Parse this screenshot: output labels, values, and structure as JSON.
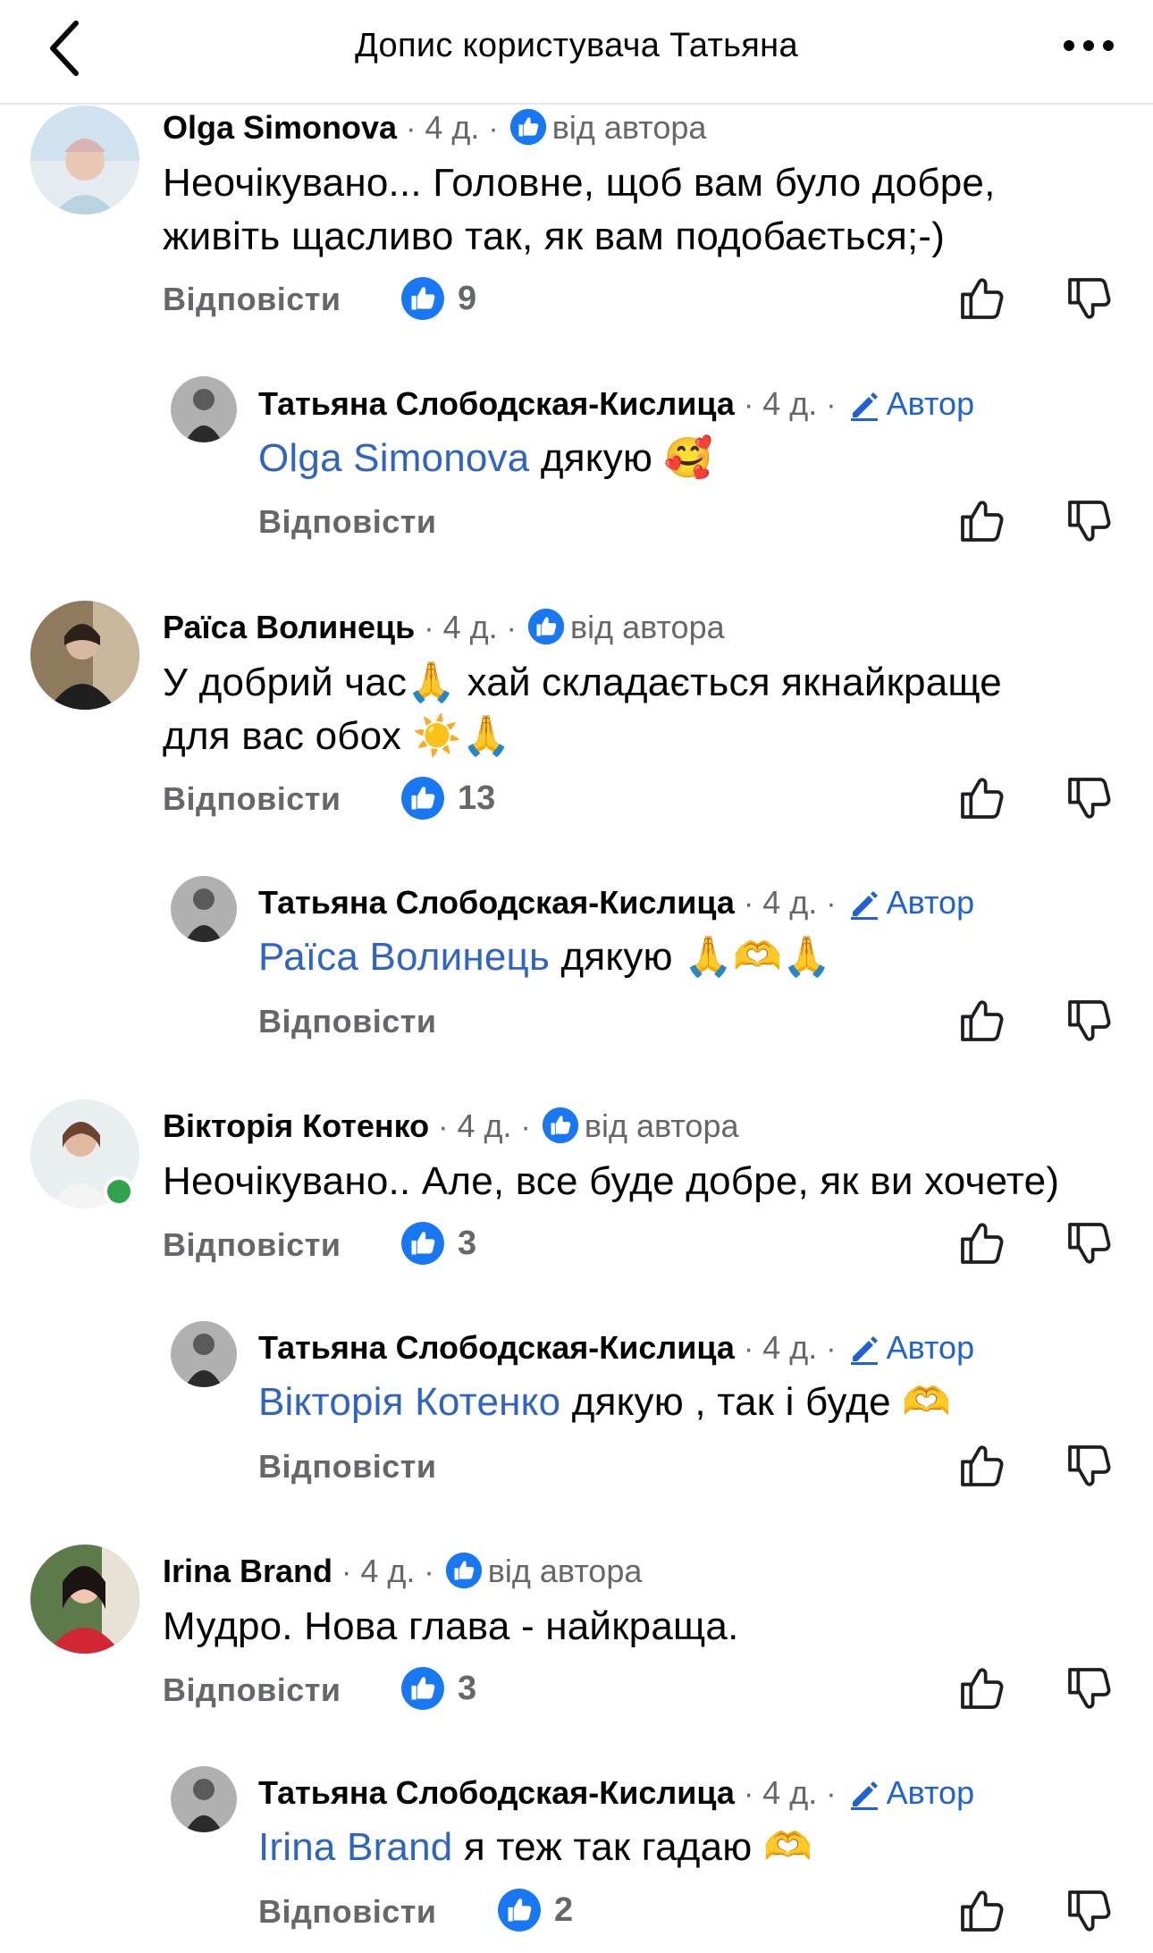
{
  "header": {
    "title": "Допис користувача Татьяна",
    "back_icon": "chevron-left-icon",
    "more_icon": "more-dots-icon"
  },
  "colors": {
    "link_blue": "#2f64c5",
    "like_blue": "#1877f2",
    "meta_gray": "#65676b",
    "online_green": "#31a24c"
  },
  "labels": {
    "reply": "Відповісти",
    "from_author": "від автора",
    "author": "Автор",
    "dot": "·"
  },
  "comments": [
    {
      "author": "Olga Simonova",
      "time": "4 д.",
      "text_line1": "Неочікувано... Головне, щоб вам було добре,",
      "text_line2": "живіть щасливо так, як вам подобається;-)",
      "likes": "9",
      "reply": {
        "author": "Татьяна Слободская-Кислица",
        "time": "4 д.",
        "mention": "Olga Simonova",
        "text": " дякую ",
        "emoji": "🥰"
      }
    },
    {
      "author": "Раїса Волинець",
      "time": "4 д.",
      "text_line1": "У добрий час",
      "emoji1": "🙏",
      "text_line1b": " хай складається якнайкраще",
      "text_line2": "для вас обох ",
      "emoji2": "☀️🙏",
      "likes": "13",
      "reply": {
        "author": "Татьяна Слободская-Кислица",
        "time": "4 д.",
        "mention": "Раїса Волинець",
        "text": " дякую ",
        "emoji": "🙏🫶🙏"
      }
    },
    {
      "author": "Вікторія Котенко",
      "time": "4 д.",
      "text_line1": "Неочікувано.. Але, все буде добре, як ви хочете)",
      "likes": "3",
      "reply": {
        "author": "Татьяна Слободская-Кислица",
        "time": "4 д.",
        "mention": "Вікторія Котенко",
        "text": " дякую , так і буде ",
        "emoji": "🫶"
      }
    },
    {
      "author": "Irina Brand",
      "time": "4 д.",
      "text_line1": "Мудро. Нова глава - найкраща.",
      "likes": "3",
      "reply": {
        "author": "Татьяна Слободская-Кислица",
        "time": "4 д.",
        "mention": "Irina Brand",
        "text": " я теж так гадаю ",
        "emoji": "🫶",
        "likes": "2"
      }
    }
  ]
}
